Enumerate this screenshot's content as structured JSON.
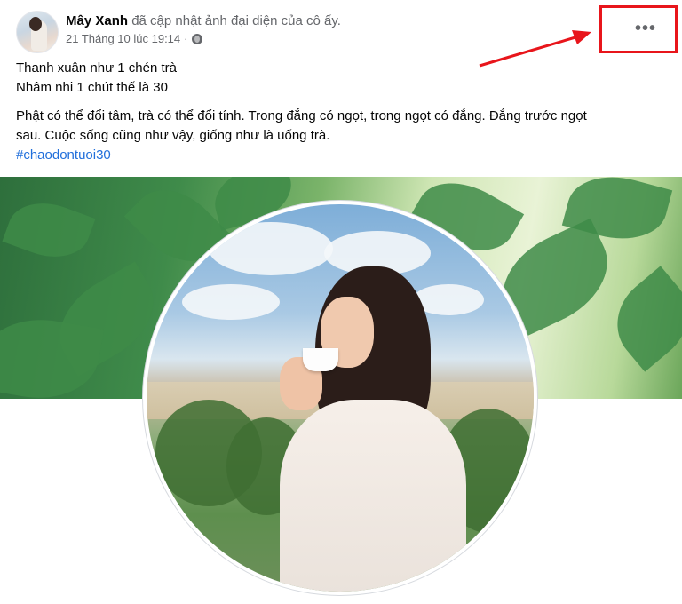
{
  "post": {
    "author_name": "Mây Xanh",
    "action_text": "đã cập nhật ảnh đại diện của cô ấy.",
    "timestamp": "21 Tháng 10 lúc 19:14",
    "separator": "·",
    "privacy_icon": "globe-icon",
    "more_icon_glyph": "•••",
    "caption_lines": [
      "Thanh xuân như 1 chén trà",
      "Nhâm nhi 1 chút thế là 30",
      "Phật có thể đổi tâm, trà có thể đổi tính. Trong đắng có ngọt, trong ngọt có đắng. Đắng trước ngọt",
      "sau. Cuộc sống cũng như vậy, giống như là uống trà."
    ],
    "hashtag": "#chaodontuoi30"
  },
  "annotation": {
    "highlight_color": "#e8151b",
    "arrow_color": "#e8151b"
  },
  "colors": {
    "link": "#216fdb",
    "secondary_text": "#65676b",
    "primary_text": "#050505"
  }
}
